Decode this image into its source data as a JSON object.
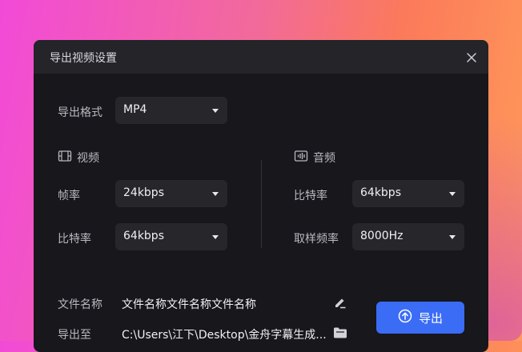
{
  "dialog": {
    "title": "导出视频设置",
    "format": {
      "label": "导出格式",
      "value": "MP4"
    },
    "video": {
      "heading": "视频",
      "frame_rate": {
        "label": "帧率",
        "value": "24kbps"
      },
      "bitrate": {
        "label": "比特率",
        "value": "64kbps"
      }
    },
    "audio": {
      "heading": "音频",
      "bitrate": {
        "label": "比特率",
        "value": "64kbps"
      },
      "sample_rate": {
        "label": "取样频率",
        "value": "8000Hz"
      }
    },
    "file": {
      "name_label": "文件名称",
      "name_value": "文件名称文件名称文件名称",
      "path_label": "导出至",
      "path_value": "C:\\Users\\江下\\Desktop\\金舟字幕生成..."
    },
    "export_label": "导出"
  },
  "colors": {
    "accent": "#3a6cf6",
    "dialog_bg": "#17171c",
    "titlebar_bg": "#242429",
    "select_bg": "#26262b"
  },
  "icons": {
    "close": "close-icon",
    "video": "film-icon",
    "audio": "waveform-icon",
    "edit": "pencil-icon",
    "folder": "folder-icon",
    "export": "upload-icon",
    "caret": "caret-down-icon"
  }
}
